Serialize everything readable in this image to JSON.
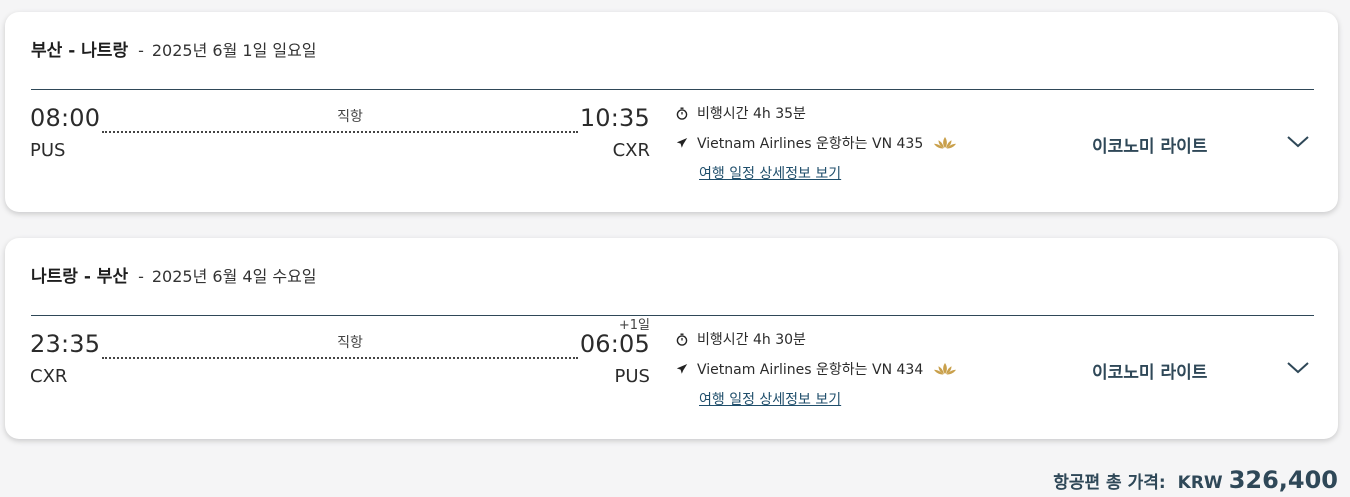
{
  "itinerary": [
    {
      "route": "부산 - 나트랑",
      "separator": "-",
      "date": "2025년 6월 1일 일요일",
      "departure_time": "08:00",
      "departure_code": "PUS",
      "arrival_time": "10:35",
      "arrival_code": "CXR",
      "stops": "직항",
      "day_offset": "",
      "duration": "비행시간 4h 35분",
      "operator": "Vietnam Airlines 운항하는 VN 435",
      "details_link": "여행 일정 상세정보 보기",
      "cabin": "이코노미 라이트",
      "icons": [
        "stopwatch-icon",
        "plane-icon",
        "lotus-logo-icon",
        "chevron-down-icon"
      ]
    },
    {
      "route": "나트랑 - 부산",
      "separator": "-",
      "date": "2025년 6월 4일 수요일",
      "departure_time": "23:35",
      "departure_code": "CXR",
      "arrival_time": "06:05",
      "arrival_code": "PUS",
      "stops": "직항",
      "day_offset": "+1일",
      "duration": "비행시간 4h 30분",
      "operator": "Vietnam Airlines 운항하는 VN 434",
      "details_link": "여행 일정 상세정보 보기",
      "cabin": "이코노미 라이트",
      "icons": [
        "stopwatch-icon",
        "plane-icon",
        "lotus-logo-icon",
        "chevron-down-icon"
      ]
    }
  ],
  "total": {
    "label": "항공편 총 가격:",
    "currency": "KRW",
    "amount": "326,400"
  },
  "colors": {
    "accent": "#2f4858",
    "link": "#1f4e6b",
    "lotus_gold": "#c9a04b",
    "background": "#f5f5f6"
  }
}
